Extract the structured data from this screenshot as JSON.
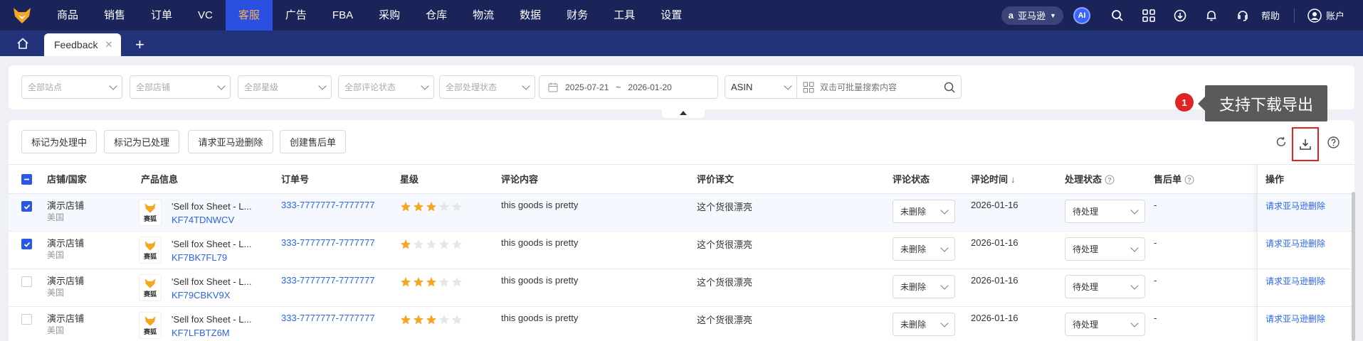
{
  "nav": {
    "items": [
      "商品",
      "销售",
      "订单",
      "VC",
      "客服",
      "广告",
      "FBA",
      "采购",
      "仓库",
      "物流",
      "数据",
      "财务",
      "工具",
      "设置"
    ],
    "active": "客服",
    "marketplace": "亚马逊",
    "ai_label": "AI",
    "help": "帮助",
    "account": "账户"
  },
  "tabs": {
    "current": "Feedback",
    "close": "✕",
    "add": "+"
  },
  "filters": {
    "site": "全部站点",
    "store": "全部店铺",
    "rating": "全部星级",
    "review_status": "全部评论状态",
    "process_status": "全部处理状态",
    "date_start": "2025-07-21",
    "date_sep": "~",
    "date_end": "2026-01-20",
    "field": "ASIN",
    "search_placeholder": "双击可批量搜索内容"
  },
  "tooltip": {
    "badge": "1",
    "text": "支持下载导出"
  },
  "toolbar": {
    "mark_processing": "标记为处理中",
    "mark_processed": "标记为已处理",
    "request_delete": "请求亚马逊删除",
    "create_after_sale": "创建售后单"
  },
  "table": {
    "headers": {
      "store": "店铺/国家",
      "product": "产品信息",
      "order": "订单号",
      "rating": "星级",
      "comment": "评论内容",
      "translation": "评价译文",
      "review_status": "评论状态",
      "review_time": "评论时间",
      "sort_arrow": "↓",
      "process_status": "处理状态",
      "after_sale": "售后单",
      "action": "操作"
    },
    "rows": [
      {
        "checked": true,
        "store": "演示店铺",
        "country": "美国",
        "brand": "赛狐",
        "title": "'Sell fox Sheet - L...",
        "sku": "KF74TDNWCV",
        "order": "333-7777777-7777777",
        "stars": 3,
        "comment": "this goods is pretty",
        "translation": "这个货很漂亮",
        "review_status": "未删除",
        "time": "2026-01-16",
        "process": "待处理",
        "after": "-",
        "action": "请求亚马逊删除"
      },
      {
        "checked": true,
        "store": "演示店铺",
        "country": "美国",
        "brand": "赛狐",
        "title": "'Sell fox Sheet - L...",
        "sku": "KF7BK7FL79",
        "order": "333-7777777-7777777",
        "stars": 1,
        "comment": "this goods is pretty",
        "translation": "这个货很漂亮",
        "review_status": "未删除",
        "time": "2026-01-16",
        "process": "待处理",
        "after": "-",
        "action": "请求亚马逊删除"
      },
      {
        "checked": false,
        "store": "演示店铺",
        "country": "美国",
        "brand": "赛狐",
        "title": "'Sell fox Sheet - L...",
        "sku": "KF79CBKV9X",
        "order": "333-7777777-7777777",
        "stars": 3,
        "comment": "this goods is pretty",
        "translation": "这个货很漂亮",
        "review_status": "未删除",
        "time": "2026-01-16",
        "process": "待处理",
        "after": "-",
        "action": "请求亚马逊删除"
      },
      {
        "checked": false,
        "store": "演示店铺",
        "country": "美国",
        "brand": "赛狐",
        "title": "'Sell fox Sheet - L...",
        "sku": "KF7LFBTZ6M",
        "order": "333-7777777-7777777",
        "stars": 3,
        "comment": "this goods is pretty",
        "translation": "这个货很漂亮",
        "review_status": "未删除",
        "time": "2026-01-16",
        "process": "待处理",
        "after": "-",
        "action": "请求亚马逊删除"
      }
    ]
  },
  "colors": {
    "nav_bg": "#1a2459",
    "accent": "#2b57e8",
    "active_text": "#ffb14a",
    "star": "#f5a623",
    "highlight": "#e02424"
  }
}
